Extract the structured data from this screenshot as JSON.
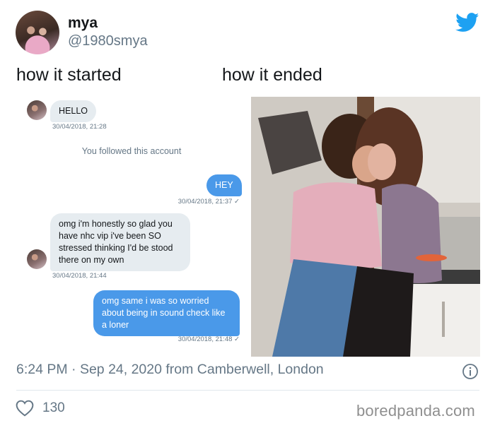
{
  "tweet": {
    "display_name": "mya",
    "handle": "@1980smya",
    "caption_left": "how it started",
    "caption_right": "how it ended",
    "meta": "6:24 PM · Sep 24, 2020 from Camberwell, London",
    "like_count": "130",
    "accent_color": "#1da1f2"
  },
  "dm": {
    "messages": [
      {
        "direction": "in",
        "text": "HELLO",
        "timestamp": "30/04/2018, 21:28"
      },
      {
        "direction": "system",
        "text": "You followed this account"
      },
      {
        "direction": "out",
        "text": "HEY",
        "timestamp": "30/04/2018, 21:37 ✓"
      },
      {
        "direction": "in",
        "lines": [
          "omg i'm honestly so glad you",
          "have nhc vip i've been SO",
          "stressed thinking I'd be stood",
          "there on my own"
        ],
        "timestamp": "30/04/2018, 21:44"
      },
      {
        "direction": "out",
        "lines": [
          "omg same i was so worried",
          "about being in sound check like",
          "a loner"
        ],
        "timestamp": "30/04/2018, 21:48 ✓"
      }
    ],
    "in_bubble_color": "#e6ecf0",
    "out_bubble_color": "#4a99e9"
  },
  "watermark": "boredpanda.com",
  "icons": [
    "twitter-bird-icon",
    "info-icon",
    "heart-icon"
  ]
}
